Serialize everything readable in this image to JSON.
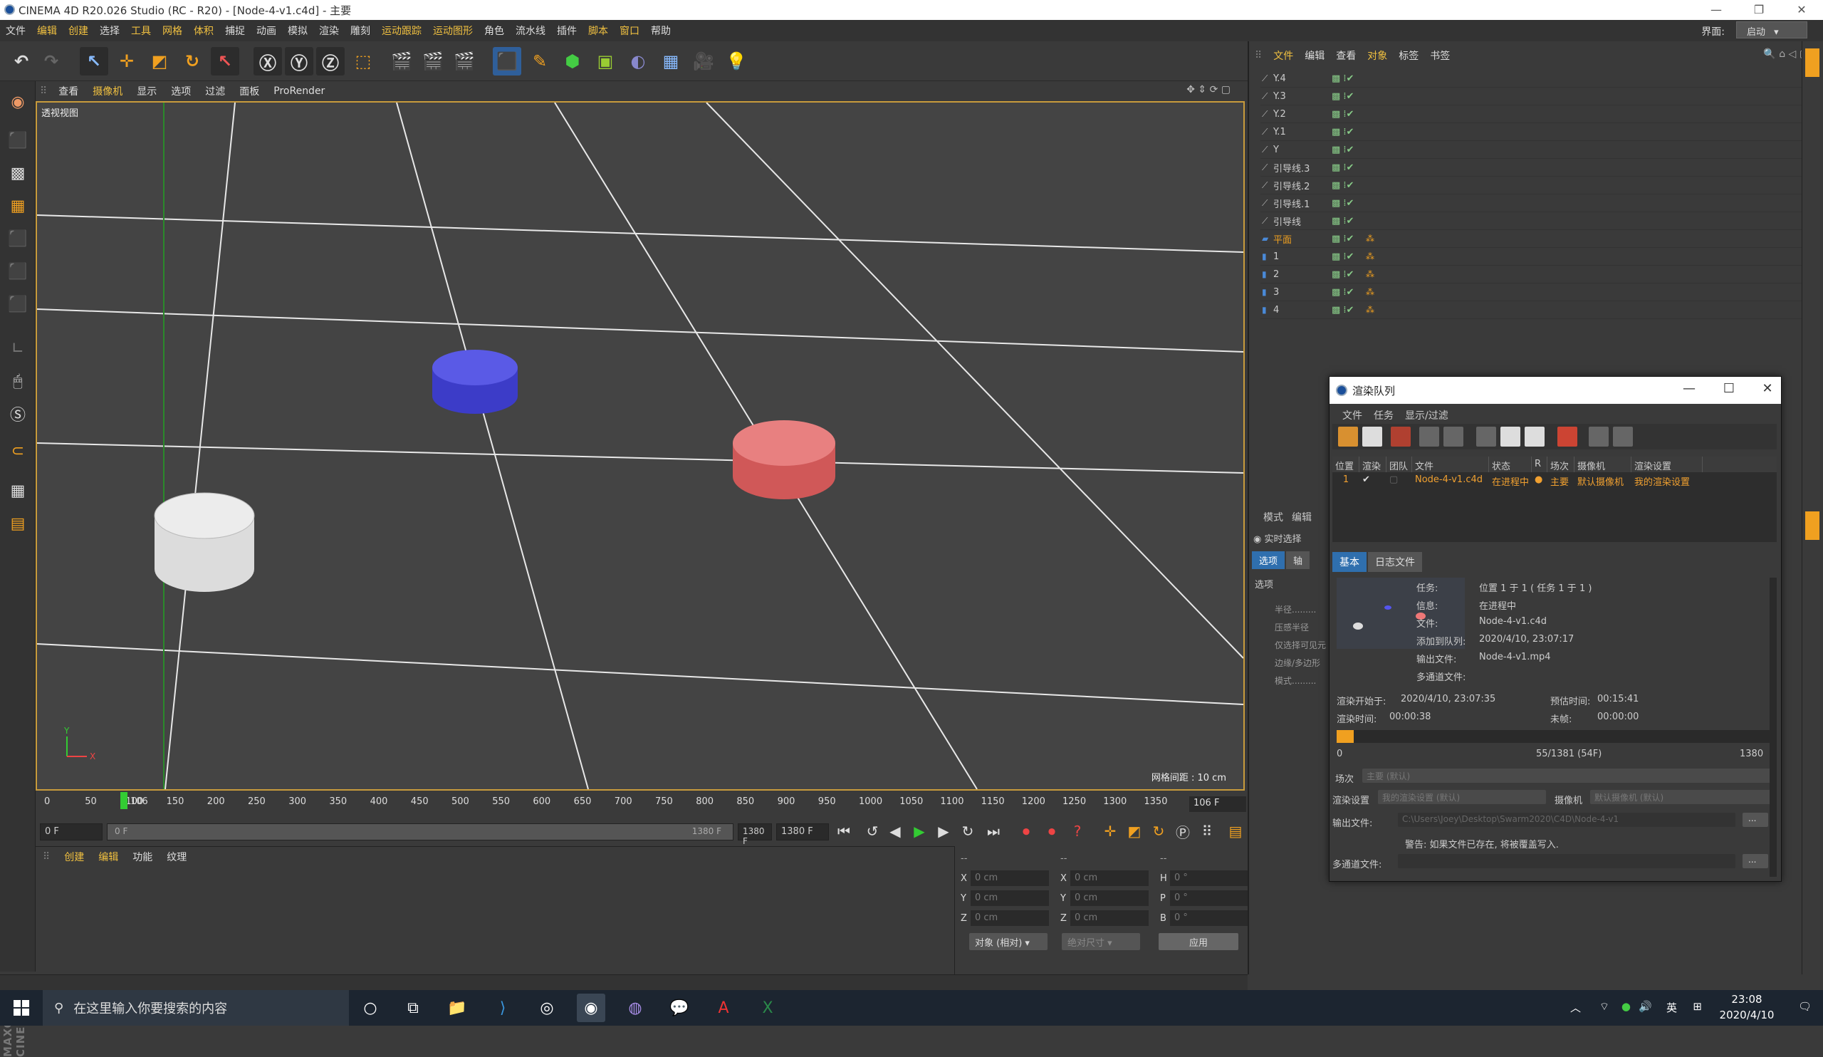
{
  "window": {
    "title": "CINEMA 4D R20.026 Studio (RC - R20) - [Node-4-v1.c4d] - 主要"
  },
  "menubar": {
    "items": [
      "文件",
      "编辑",
      "创建",
      "选择",
      "工具",
      "网格",
      "体积",
      "捕捉",
      "动画",
      "模拟",
      "渲染",
      "雕刻",
      "运动跟踪",
      "运动图形",
      "角色",
      "流水线",
      "插件",
      "脚本",
      "窗口",
      "帮助"
    ],
    "layout_label": "界面:",
    "layout_value": "启动"
  },
  "viewport": {
    "menu": [
      "查看",
      "摄像机",
      "显示",
      "选项",
      "过滤",
      "面板",
      "ProRender"
    ],
    "label": "透视视图",
    "grid_spacing": "网格间距 : 10 cm",
    "axis_y": "Y",
    "axis_x": "X"
  },
  "timeline": {
    "ticks": [
      "0",
      "50",
      "100",
      "150",
      "200",
      "250",
      "300",
      "350",
      "400",
      "450",
      "500",
      "550",
      "600",
      "650",
      "700",
      "750",
      "800",
      "850",
      "900",
      "950",
      "1000",
      "1050",
      "1100",
      "1150",
      "1200",
      "1250",
      "1300",
      "1350"
    ],
    "current_marker": "106",
    "frame_field": "106 F",
    "start_field": "0 F",
    "range_start": "0 F",
    "range_end": "1380 F",
    "end_field_a": "1380 F",
    "end_field_b": "1380 F",
    "progress": 0.077
  },
  "bottom_panel": {
    "menu": [
      "创建",
      "编辑",
      "功能",
      "纹理"
    ]
  },
  "coords": {
    "headers": [
      "--",
      "--",
      "--"
    ],
    "rows": [
      {
        "a": "X",
        "av": "0 cm",
        "b": "X",
        "bv": "0 cm",
        "c": "H",
        "cv": "0 °"
      },
      {
        "a": "Y",
        "av": "0 cm",
        "b": "Y",
        "bv": "0 cm",
        "c": "P",
        "cv": "0 °"
      },
      {
        "a": "Z",
        "av": "0 cm",
        "b": "Z",
        "bv": "0 cm",
        "c": "B",
        "cv": "0 °"
      }
    ],
    "mode_select": "对象 (相对)",
    "size_select": "绝对尺寸",
    "apply_button": "应用"
  },
  "object_manager": {
    "menu": [
      "文件",
      "编辑",
      "查看",
      "对象",
      "标签",
      "书签"
    ],
    "objects": [
      {
        "name": "Y.4",
        "type": "spline"
      },
      {
        "name": "Y.3",
        "type": "spline"
      },
      {
        "name": "Y.2",
        "type": "spline"
      },
      {
        "name": "Y.1",
        "type": "spline"
      },
      {
        "name": "Y",
        "type": "spline"
      },
      {
        "name": "引导线.3",
        "type": "spline"
      },
      {
        "name": "引导线.2",
        "type": "spline"
      },
      {
        "name": "引导线.1",
        "type": "spline"
      },
      {
        "name": "引导线",
        "type": "spline"
      },
      {
        "name": "平面",
        "type": "plane"
      },
      {
        "name": "1",
        "type": "cylinder"
      },
      {
        "name": "2",
        "type": "cylinder"
      },
      {
        "name": "3",
        "type": "cylinder"
      },
      {
        "name": "4",
        "type": "cylinder"
      }
    ]
  },
  "attributes": {
    "menu": [
      "模式",
      "编辑"
    ],
    "realtime": "实时选择",
    "tabs": [
      "选项",
      "轴"
    ],
    "section": "选项",
    "props": [
      "半径.........",
      "压感半径",
      "仅选择可见元",
      "边缘/多边形",
      "模式........."
    ]
  },
  "render_queue": {
    "title": "渲染队列",
    "menu": [
      "文件",
      "任务",
      "显示/过滤"
    ],
    "columns": [
      "位置",
      "渲染",
      "团队",
      "文件",
      "状态",
      "R",
      "场次",
      "摄像机",
      "渲染设置"
    ],
    "job": {
      "pos": "1",
      "file": "Node-4-v1.c4d",
      "status": "在进程中",
      "take": "主要",
      "camera": "默认摄像机",
      "settings": "我的渲染设置"
    },
    "tabs": [
      "基本",
      "日志文件"
    ],
    "info": [
      {
        "label": "任务:",
        "value": "位置 1 于 1 ( 任务 1 于 1 )"
      },
      {
        "label": "信息:",
        "value": "在进程中"
      },
      {
        "label": "文件:",
        "value": "Node-4-v1.c4d"
      },
      {
        "label": "添加到队列:",
        "value": "2020/4/10, 23:07:17"
      },
      {
        "label": "输出文件:",
        "value": "Node-4-v1.mp4"
      },
      {
        "label": "多通道文件:",
        "value": ""
      }
    ],
    "render_start_label": "渲染开始于:",
    "render_start": "2020/4/10, 23:07:35",
    "estimated_label": "预估时间:",
    "estimated": "00:15:41",
    "render_time_label": "渲染时间:",
    "render_time": "00:00:38",
    "remaining_label": "未帧:",
    "remaining": "00:00:00",
    "progress_min": "0",
    "progress_text": "55/1381 (54F)",
    "progress_max": "1380",
    "progress": 0.04,
    "take_label": "场次",
    "take_value": "主要 (默认)",
    "rs_label": "渲染设置",
    "rs_value": "我的渲染设置 (默认)",
    "cam_label": "摄像机",
    "cam_value": "默认摄像机 (默认)",
    "output_label": "输出文件:",
    "output_value": "C:\\Users\\Joey\\Desktop\\Swarm2020\\C4D\\Node-4-v1",
    "warning": "警告: 如果文件已存在, 将被覆盖写入.",
    "multipass_label": "多通道文件:",
    "browse": "..."
  },
  "taskbar": {
    "search_placeholder": "在这里输入你要搜索的内容",
    "tray_lang": "英",
    "time": "23:08",
    "date": "2020/4/10"
  },
  "colors": {
    "accent": "#f0c040",
    "cyl_white": "#e0e0e0",
    "cyl_blue": "#4a4ad8",
    "cyl_red": "#e87070"
  }
}
